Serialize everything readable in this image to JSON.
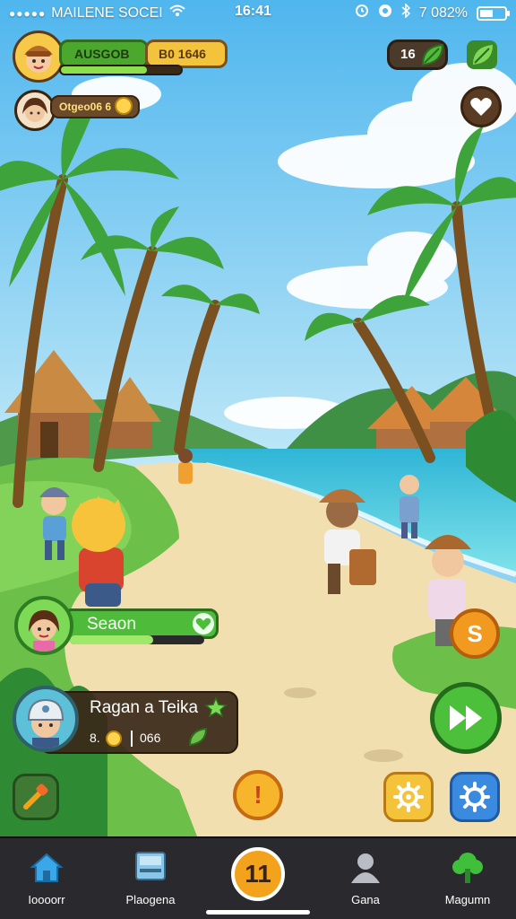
{
  "status": {
    "carrier": "MAILENE SOCEI",
    "time": "16:41",
    "battery": "7 082%",
    "battery_fraction": 0.55
  },
  "hud": {
    "player_name": "AUSGOB",
    "score": "B0 1646",
    "xp_fraction": 0.72,
    "companion_label": "Otgeo06 6",
    "leaf_count": "16",
    "icons": {
      "avatar": "boy-avatar-icon",
      "companion": "girl-avatar-icon",
      "leaf": "leaf-icon",
      "heart": "heart-icon"
    }
  },
  "season": {
    "label": "Seaon",
    "progress_fraction": 0.62
  },
  "quest": {
    "title": "Ragan a Teika",
    "stat_left": "8.",
    "stat_right": "066"
  },
  "actions": {
    "hint_label": "!",
    "coin_label": "S"
  },
  "nav": {
    "items": [
      {
        "label": "Ioooorr",
        "icon": "house-icon"
      },
      {
        "label": "Plaogena",
        "icon": "map-board-icon"
      },
      {
        "label": "Gana",
        "icon": "person-icon"
      },
      {
        "label": "Magumn",
        "icon": "tree-icon"
      }
    ],
    "center_label": "11"
  },
  "colors": {
    "sky": "#8fd3f4",
    "sea": "#3fc6d8",
    "sand": "#f2dfb0",
    "grass": "#6cc04a",
    "nav_bg": "#2a2a2e"
  }
}
